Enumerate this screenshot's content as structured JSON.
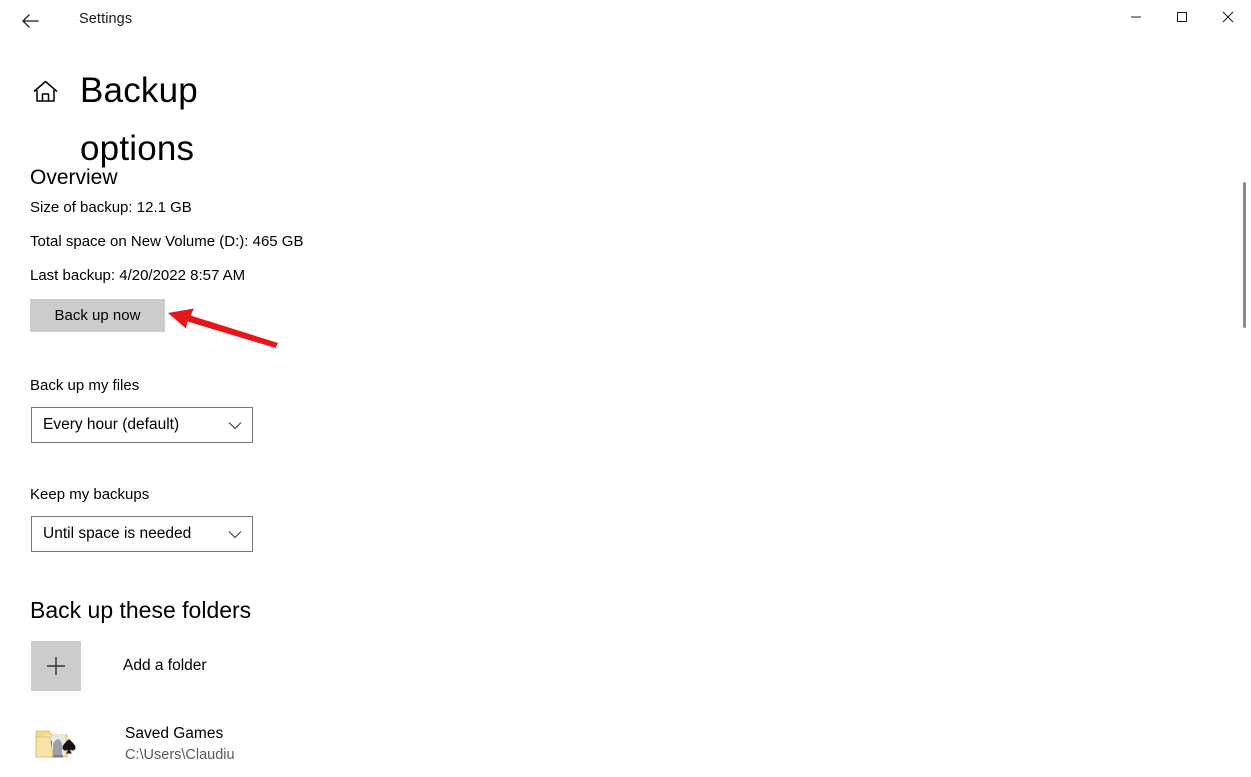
{
  "window": {
    "titlebar_title": "Settings",
    "minimize_label": "Minimize",
    "maximize_label": "Maximize",
    "close_label": "Close",
    "back_label": "Back"
  },
  "header": {
    "home_icon": "home-icon",
    "page_title": "Backup options"
  },
  "overview": {
    "heading": "Overview",
    "size_of_backup": "Size of backup: 12.1 GB",
    "total_space": "Total space on New Volume (D:): 465 GB",
    "last_backup": "Last backup: 4/20/2022 8:57 AM",
    "backup_now_button": "Back up now"
  },
  "annotation": {
    "arrow_color": "#e8151b",
    "target": "Back up now"
  },
  "settings": {
    "backup_files": {
      "label": "Back up my files",
      "selected": "Every hour (default)"
    },
    "keep_backups": {
      "label": "Keep my backups",
      "selected": "Until space is needed"
    }
  },
  "folders": {
    "heading": "Back up these folders",
    "add_folder_label": "Add a folder",
    "add_folder_icon": "plus-icon",
    "items": [
      {
        "name": "Saved Games",
        "path": "C:\\Users\\Claudiu",
        "icon": "folder-saved-games-icon"
      }
    ]
  },
  "colors": {
    "button_gray": "#cccccc",
    "combo_border": "#767676",
    "accent_red": "#e8151b",
    "background": "#ffffff",
    "scrollbar_thumb": "#8a8a8a"
  }
}
